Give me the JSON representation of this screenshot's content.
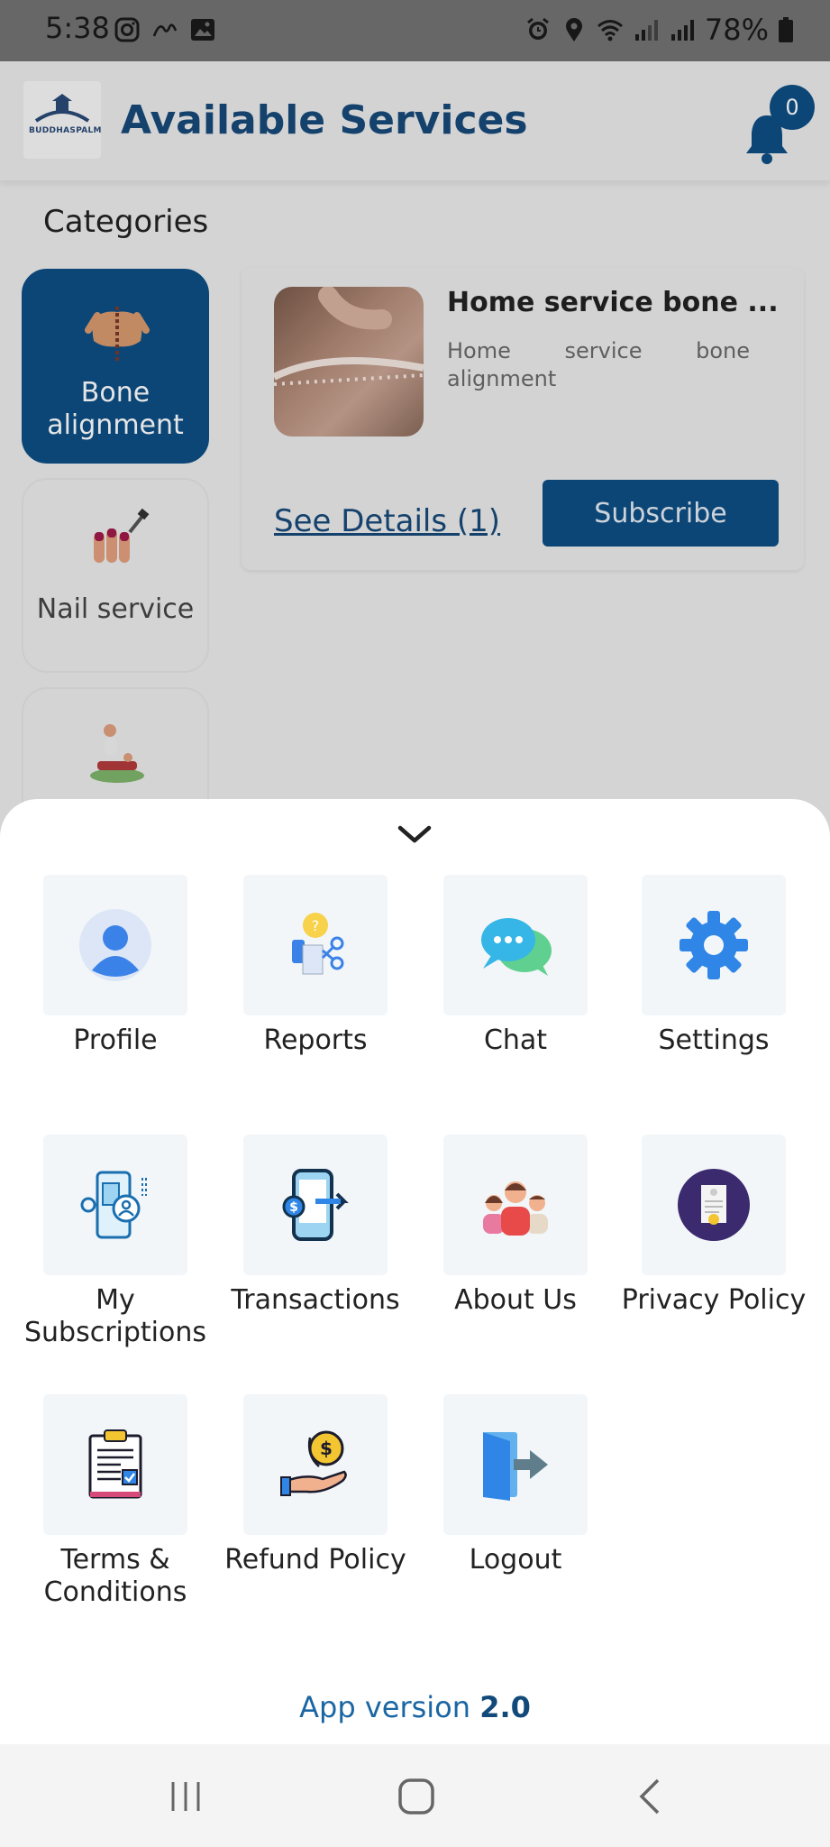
{
  "status_bar": {
    "time": "5:38",
    "battery": "78%"
  },
  "header": {
    "title": "Available Services",
    "logo_text": "BUDDHASPALM",
    "notification_count": "0"
  },
  "categories": {
    "label": "Categories",
    "items": [
      {
        "label": "Bone alignment",
        "icon": "spine-icon",
        "active": true
      },
      {
        "label": "Nail service",
        "icon": "nail-polish-icon",
        "active": false
      },
      {
        "label": "",
        "icon": "massage-icon",
        "active": false
      }
    ]
  },
  "service": {
    "title": "Home service bone ...",
    "description": "Home service bone",
    "description_line2": "alignment",
    "details_link": "See Details (1)",
    "subscribe_label": "Subscribe"
  },
  "menu": {
    "items": [
      {
        "label": "Profile",
        "icon": "profile-icon"
      },
      {
        "label": "Reports",
        "icon": "reports-icon"
      },
      {
        "label": "Chat",
        "icon": "chat-icon"
      },
      {
        "label": "Settings",
        "icon": "gear-icon"
      },
      {
        "label": "My Subscriptions",
        "icon": "subscriptions-icon"
      },
      {
        "label": "Transactions",
        "icon": "transactions-icon"
      },
      {
        "label": "About Us",
        "icon": "about-us-icon"
      },
      {
        "label": "Privacy Policy",
        "icon": "privacy-policy-icon"
      },
      {
        "label": "Terms & Conditions",
        "icon": "terms-icon"
      },
      {
        "label": "Refund Policy",
        "icon": "refund-icon"
      },
      {
        "label": "Logout",
        "icon": "logout-icon"
      }
    ]
  },
  "footer": {
    "version_label": "App version",
    "version_number": "2.0"
  },
  "colors": {
    "primary": "#0d4e85",
    "title": "#184a7a",
    "tile_bg": "#f2f6f9"
  }
}
